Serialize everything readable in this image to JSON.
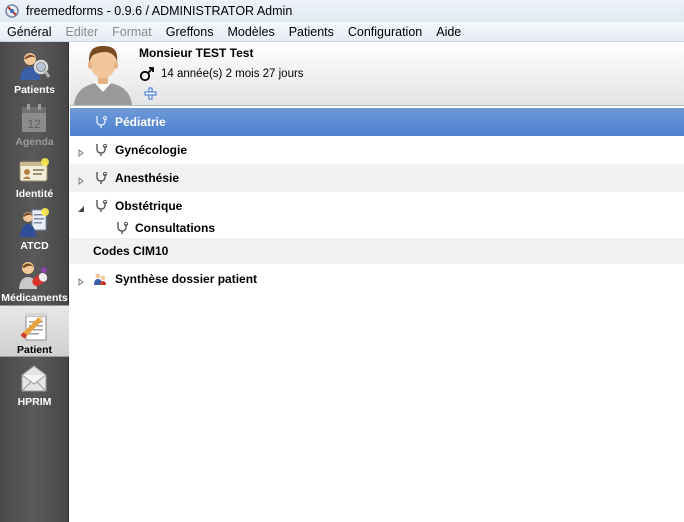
{
  "window": {
    "title": "freemedforms - 0.9.6 /  ADMINISTRATOR Admin"
  },
  "menubar": {
    "items": [
      {
        "label": "Général",
        "enabled": true
      },
      {
        "label": "Editer",
        "enabled": false
      },
      {
        "label": "Format",
        "enabled": false
      },
      {
        "label": "Greffons",
        "enabled": true
      },
      {
        "label": "Modèles",
        "enabled": true
      },
      {
        "label": "Patients",
        "enabled": true
      },
      {
        "label": "Configuration",
        "enabled": true
      },
      {
        "label": "Aide",
        "enabled": true
      }
    ]
  },
  "modebar": {
    "items": [
      {
        "label": "Patients",
        "icon": "patients-icon",
        "state": "normal"
      },
      {
        "label": "Agenda",
        "icon": "calendar-icon",
        "state": "disabled",
        "calendar_day": "12"
      },
      {
        "label": "Identité",
        "icon": "id-card-icon",
        "state": "normal"
      },
      {
        "label": "ATCD",
        "icon": "history-icon",
        "state": "normal"
      },
      {
        "label": "Médicaments",
        "icon": "pills-icon",
        "state": "normal"
      },
      {
        "label": "Patient",
        "icon": "patient-file-icon",
        "state": "active"
      },
      {
        "label": "HPRIM",
        "icon": "envelope-icon",
        "state": "normal"
      }
    ]
  },
  "patient": {
    "name": "Monsieur TEST Test",
    "age": "14 année(s) 2 mois 27 jours",
    "sex_icon": "male-icon"
  },
  "tree": {
    "rows": [
      {
        "label": "Pédiatrie",
        "icon": "stethoscope-icon",
        "expander": "none",
        "selected": true,
        "indent": 0
      },
      {
        "label": "Gynécologie",
        "icon": "stethoscope-icon",
        "expander": "collapsed",
        "selected": false,
        "indent": 0
      },
      {
        "label": "Anesthésie",
        "icon": "stethoscope-icon",
        "expander": "collapsed",
        "selected": false,
        "indent": 0
      },
      {
        "label": "Obstétrique",
        "icon": "stethoscope-icon",
        "expander": "expanded",
        "selected": false,
        "indent": 0
      },
      {
        "label": "Consultations",
        "icon": "stethoscope-icon",
        "expander": "none",
        "selected": false,
        "indent": 1
      },
      {
        "label": "Codes CIM10",
        "icon": "",
        "expander": "none",
        "selected": false,
        "indent": 0
      },
      {
        "label": "Synthèse dossier patient",
        "icon": "patient-summary-icon",
        "expander": "collapsed",
        "selected": false,
        "indent": 0
      }
    ]
  },
  "colors": {
    "selection": "#4b7fcf",
    "modebar": "#4f4f4f",
    "alt_row": "#f1f1f1"
  }
}
